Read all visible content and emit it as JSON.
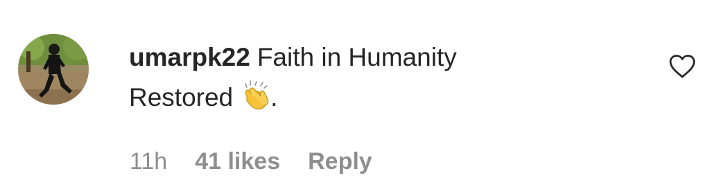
{
  "comment": {
    "username": "umarpk22",
    "text_line1": "Faith in Humanity",
    "text_line2": "Restored",
    "emoji": "clapping-hands-emoji",
    "text_after_emoji": ".",
    "time": "11h",
    "likes": "41 likes",
    "reply_label": "Reply",
    "like_icon": "heart-outline-icon"
  },
  "colors": {
    "text": "#262626",
    "secondary": "#8e8e8e",
    "emoji": "#f5c23a"
  }
}
